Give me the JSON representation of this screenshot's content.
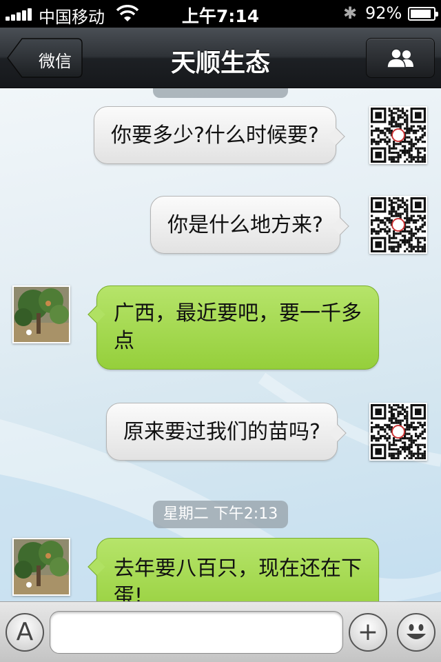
{
  "status_bar": {
    "carrier": "中国移动",
    "time": "上午7:14",
    "battery_percent": "92%",
    "battery_level": 0.92,
    "signal_bars": 5,
    "icons": [
      "signal-bars-icon",
      "wifi-icon",
      "bluetooth-icon",
      "battery-icon"
    ]
  },
  "nav": {
    "back_label": "微信",
    "title": "天顺生态",
    "right_icon": "contacts-icon"
  },
  "chat": {
    "messages": [
      {
        "side": "right",
        "text": "你要多少?什么时候要?"
      },
      {
        "side": "right",
        "text": "你是什么地方来?"
      },
      {
        "side": "left",
        "text": "广西，最近要吧，要一千多点"
      },
      {
        "side": "right",
        "text": "原来要过我们的苗吗?"
      },
      {
        "side": "left",
        "text": "去年要八百只，现在还在下蛋!"
      }
    ],
    "timestamp": "星期二 下午2:13",
    "self_avatar_icon": "qr-code-avatar-icon",
    "contact_avatar_icon": "tree-photo-avatar-icon"
  },
  "input_bar": {
    "voice_toggle_label": "A",
    "placeholder": "",
    "add_label": "+",
    "emoji_icon": "smiley-icon"
  },
  "colors": {
    "nav_bg": "#1d2024",
    "bubble_green": "#a4d94d",
    "bubble_gray": "#f0f0f0",
    "chat_bg": "#dbe9f1"
  }
}
